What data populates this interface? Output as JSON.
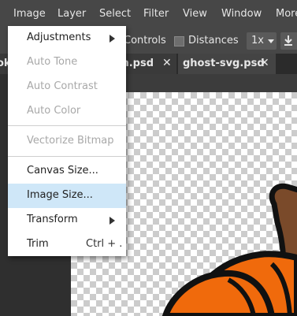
{
  "menubar": {
    "items": [
      "Image",
      "Layer",
      "Select",
      "Filter",
      "View",
      "Window",
      "More"
    ]
  },
  "options_bar": {
    "controls_label": "Controls",
    "distances_label": "Distances",
    "distances_checked": false,
    "zoom_value": "1x"
  },
  "tabs": [
    {
      "label": "ok",
      "active": false
    },
    {
      "label": "in.psd",
      "active": false
    },
    {
      "label": "ghost-svg.psd",
      "active": true
    }
  ],
  "image_menu": {
    "items": [
      {
        "label": "Adjustments",
        "disabled": false,
        "submenu": true
      },
      {
        "label": "Auto Tone",
        "disabled": true
      },
      {
        "label": "Auto Contrast",
        "disabled": true
      },
      {
        "label": "Auto Color",
        "disabled": true
      },
      {
        "label": "Vectorize Bitmap",
        "disabled": true
      },
      {
        "label": "Canvas Size...",
        "disabled": false
      },
      {
        "label": "Image Size...",
        "disabled": false,
        "highlighted": true
      },
      {
        "label": "Transform",
        "disabled": false,
        "submenu": true
      },
      {
        "label": "Trim",
        "disabled": false,
        "shortcut": "Ctrl + ."
      }
    ]
  },
  "colors": {
    "pumpkin_orange": "#f06a0c",
    "pumpkin_outline": "#111111",
    "stem_brown": "#7a4a2a",
    "menu_highlight": "#cfe7f8"
  }
}
